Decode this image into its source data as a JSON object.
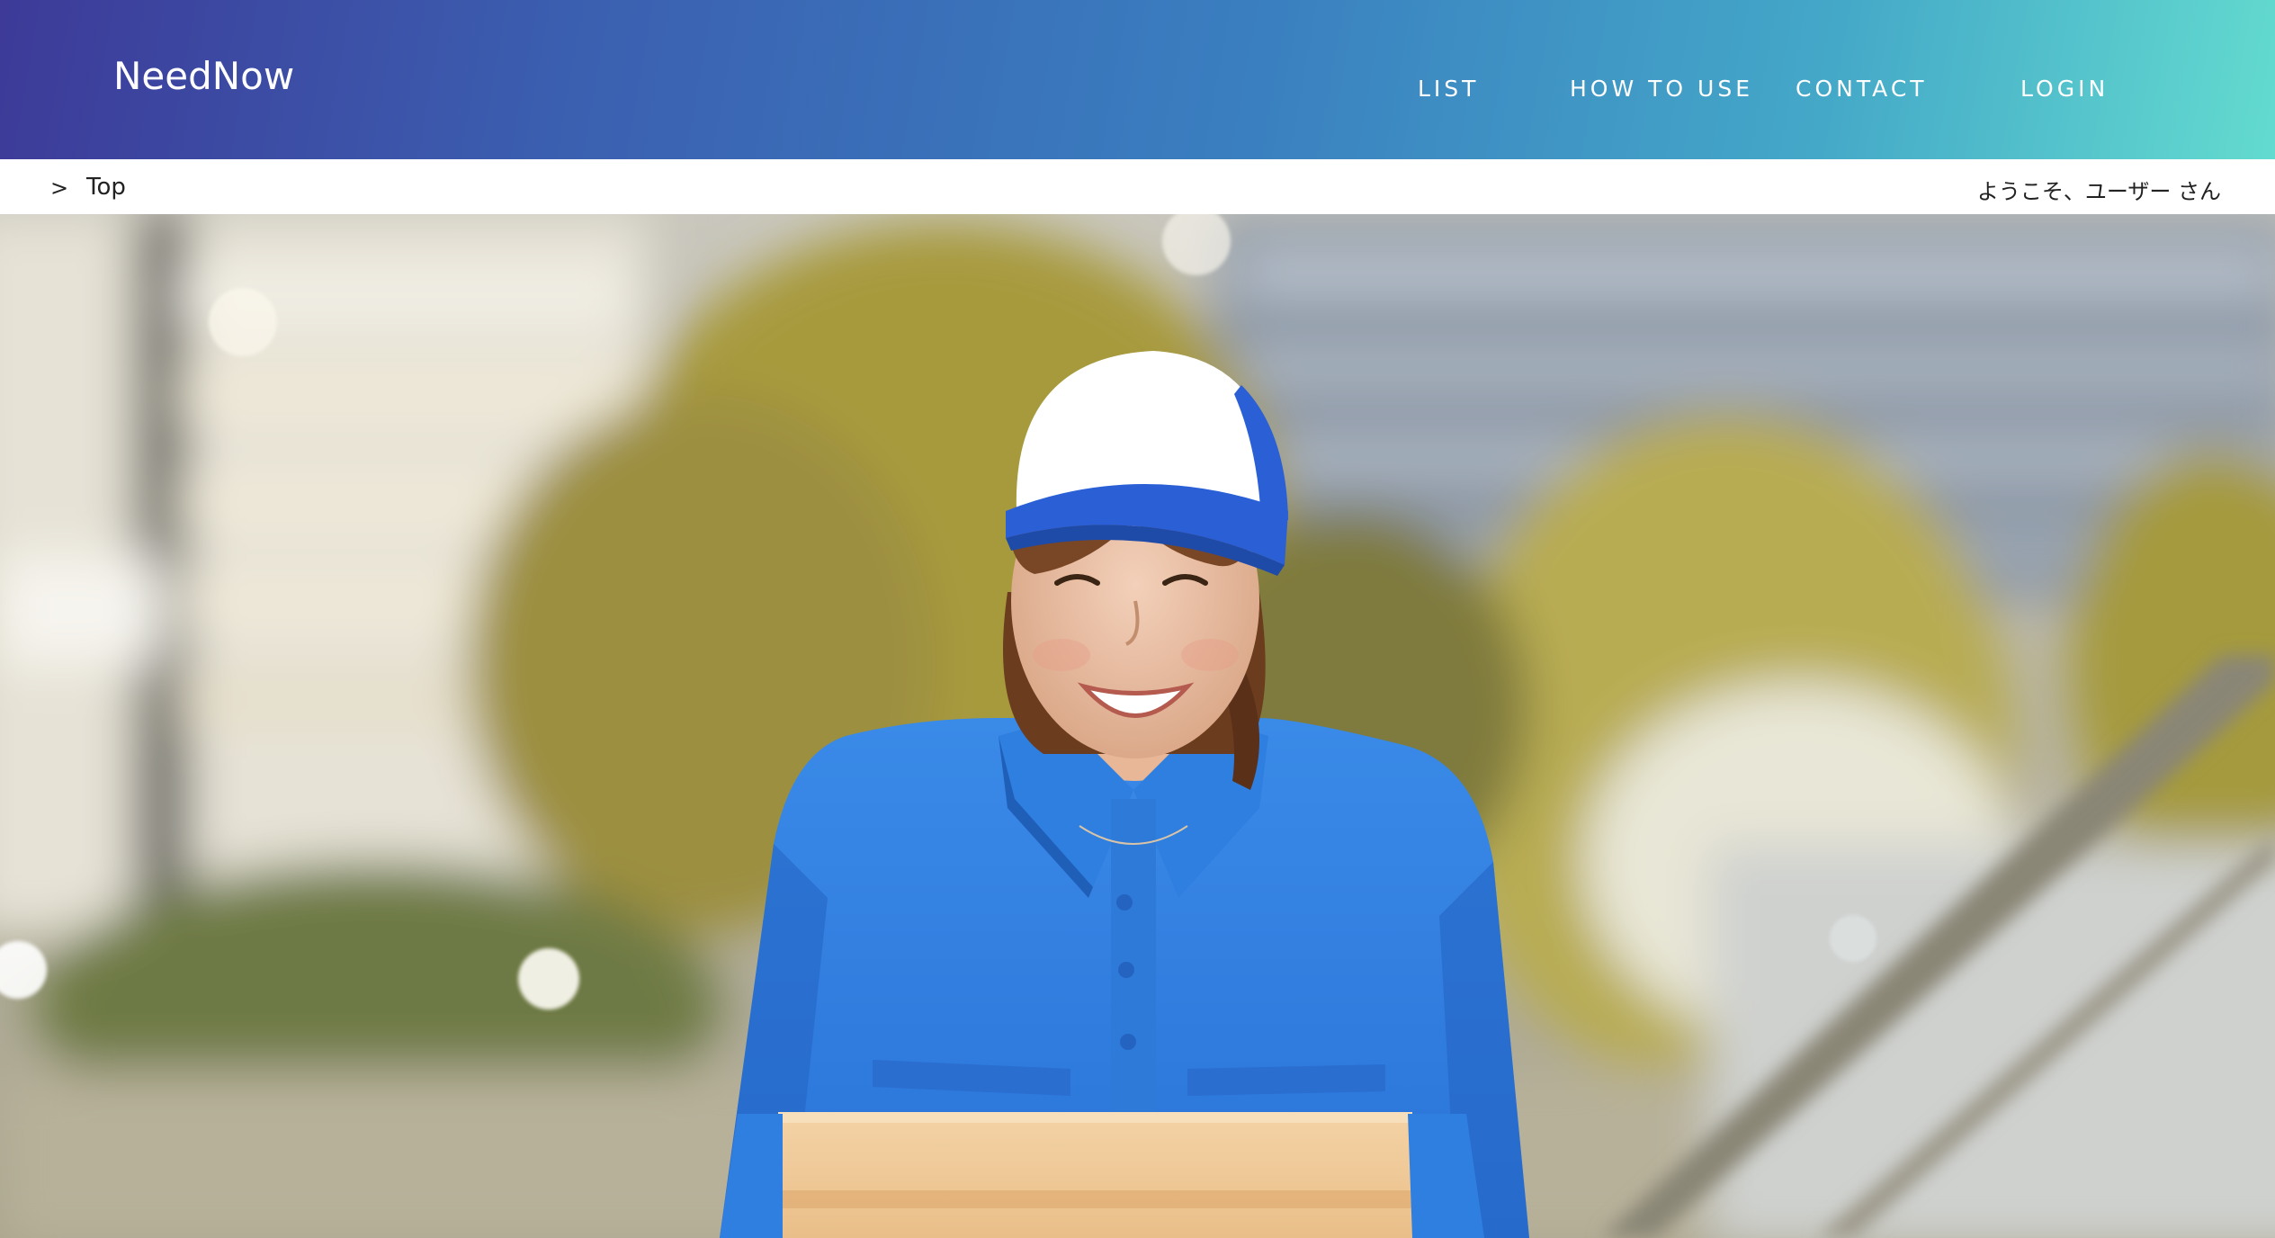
{
  "header": {
    "logo": "NeedNow",
    "nav": {
      "list": "LIST",
      "how_to_use": "HOW TO USE",
      "contact": "CONTACT",
      "login": "LOGIN"
    }
  },
  "breadcrumb": {
    "separator": ">",
    "current": "Top"
  },
  "welcome_text": "ようこそ、ユーザー さん",
  "colors": {
    "header_gradient_start": "#3d3a98",
    "header_gradient_end": "#63dbcf",
    "uniform_blue": "#2f7fe0",
    "cap_blue": "#2a5fd6"
  },
  "hero": {
    "image": "delivery-worker-photo"
  }
}
